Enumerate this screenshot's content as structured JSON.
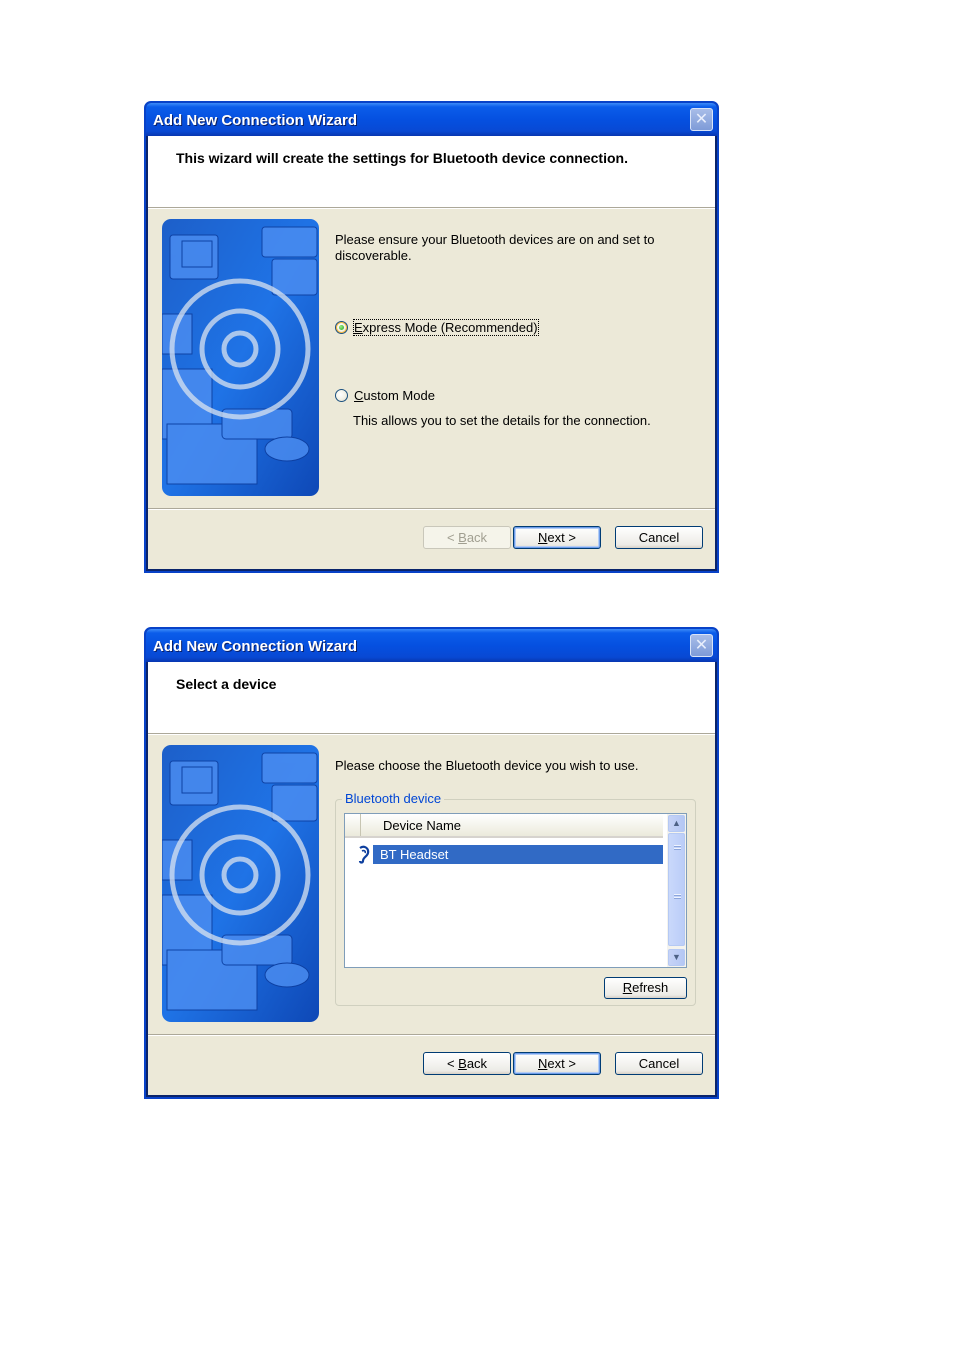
{
  "dialog1": {
    "title": "Add New Connection Wizard",
    "header": "This wizard will create the settings for Bluetooth device connection.",
    "instructions": "Please ensure your Bluetooth devices are on and set to discoverable.",
    "options": [
      {
        "label": "Express Mode (Recommended)",
        "accesskey": "E",
        "selected": true
      },
      {
        "label": "Custom Mode",
        "accesskey": "C",
        "selected": false,
        "description": "This allows you to set the details for the connection."
      }
    ],
    "buttons": {
      "back": "< Back",
      "next": "Next >",
      "cancel": "Cancel"
    },
    "back_enabled": false
  },
  "dialog2": {
    "title": "Add New Connection Wizard",
    "header": "Select a device",
    "instructions": "Please choose the Bluetooth device you wish to use.",
    "group_label": "Bluetooth device",
    "list_column": "Device Name",
    "devices": [
      {
        "name": "BT Headset",
        "icon": "headset-icon",
        "selected": true
      }
    ],
    "refresh_label": "Refresh",
    "buttons": {
      "back": "< Back",
      "next": "Next >",
      "cancel": "Cancel"
    },
    "back_enabled": true
  },
  "colors": {
    "titlebar": "#0550e0",
    "dialog_bg": "#ece9d8",
    "selection": "#316ac5",
    "group_label": "#0046d5"
  }
}
